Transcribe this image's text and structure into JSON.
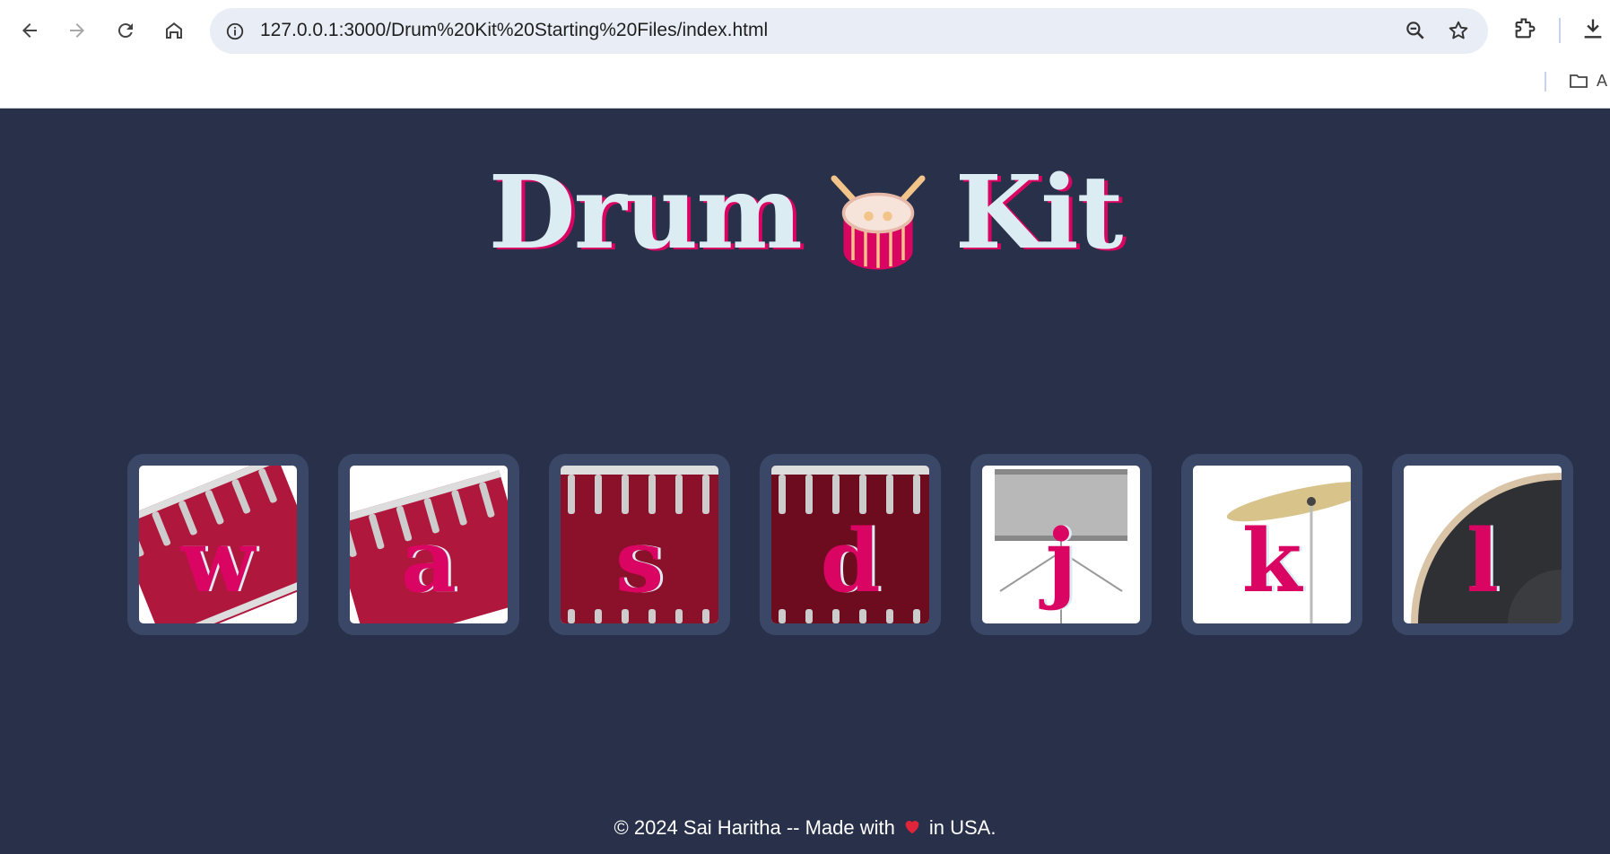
{
  "browser": {
    "url": "127.0.0.1:3000/Drum%20Kit%20Starting%20Files/index.html",
    "bookmark_label": "A"
  },
  "page": {
    "title_left": "Drum",
    "title_right": "Kit",
    "title_emoji": "drum-icon",
    "drums": [
      {
        "key": "w",
        "image": "tom-1",
        "color": "#b0173c"
      },
      {
        "key": "a",
        "image": "tom-2",
        "color": "#b0173c"
      },
      {
        "key": "s",
        "image": "tom-3",
        "color": "#8b1029"
      },
      {
        "key": "d",
        "image": "tom-4",
        "color": "#6e0c1f"
      },
      {
        "key": "j",
        "image": "snare",
        "color": "#b8b8b8"
      },
      {
        "key": "k",
        "image": "crash",
        "color": "#d8c48a"
      },
      {
        "key": "l",
        "image": "kick",
        "color": "#2e3033"
      }
    ],
    "footer_before": "© 2024 Sai Haritha -- Made with",
    "footer_after": "in USA.",
    "footer_icon": "heart-icon"
  },
  "colors": {
    "background": "#283149",
    "title": "#dbedf3",
    "accent": "#da0463",
    "tile_border": "#3a4766"
  }
}
